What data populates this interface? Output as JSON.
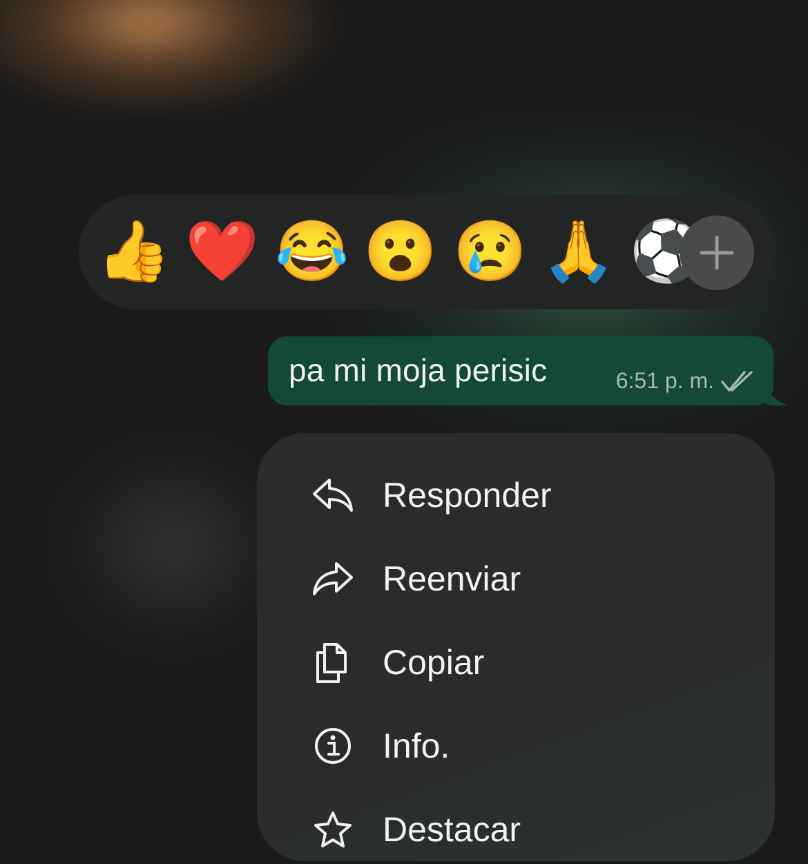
{
  "reactions": {
    "emojis": [
      {
        "name": "thumbs-up",
        "glyph": "👍"
      },
      {
        "name": "red-heart",
        "glyph": "❤️"
      },
      {
        "name": "tears-of-joy",
        "glyph": "😂"
      },
      {
        "name": "surprised-face",
        "glyph": "😮"
      },
      {
        "name": "crying-face",
        "glyph": "😢"
      },
      {
        "name": "folded-hands",
        "glyph": "🙏"
      },
      {
        "name": "soccer-ball",
        "glyph": "⚽"
      }
    ],
    "more_icon": "plus-icon"
  },
  "message": {
    "text": "pa mi moja perisic",
    "time": "6:51 p. m.",
    "status_icon": "double-check-icon"
  },
  "menu": {
    "items": [
      {
        "label": "Responder",
        "icon": "reply-icon"
      },
      {
        "label": "Reenviar",
        "icon": "forward-icon"
      },
      {
        "label": "Copiar",
        "icon": "copy-icon"
      },
      {
        "label": "Info.",
        "icon": "info-icon"
      },
      {
        "label": "Destacar",
        "icon": "star-icon"
      }
    ]
  },
  "colors": {
    "bubble": "#134a35",
    "reaction_bar": "#232525",
    "menu": "#2b2b2b",
    "background": "#1a1a1a"
  }
}
